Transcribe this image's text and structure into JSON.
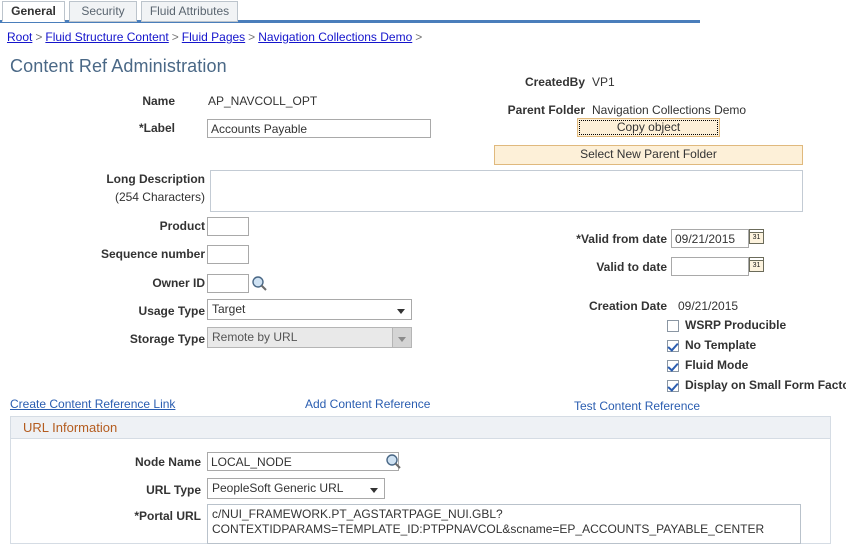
{
  "tabs": [
    {
      "label": "General",
      "active": true
    },
    {
      "label": "Security",
      "active": false
    },
    {
      "label": "Fluid Attributes",
      "active": false
    }
  ],
  "breadcrumb": {
    "items": [
      "Root",
      "Fluid Structure Content",
      "Fluid Pages",
      "Navigation Collections Demo"
    ],
    "separator": ">",
    "trailing": ">"
  },
  "page": {
    "title": "Content Ref Administration"
  },
  "general": {
    "name_label": "Name",
    "name_value": "AP_NAVCOLL_OPT",
    "label_label": "*Label",
    "label_value": "Accounts Payable",
    "long_description_label": "Long Description",
    "long_description_sub": "(254 Characters)",
    "long_description_value": "",
    "product_label": "Product",
    "product_value": "",
    "sequence_label": "Sequence number",
    "sequence_value": "",
    "owner_label": "Owner ID",
    "owner_value": "",
    "usage_type_label": "Usage Type",
    "usage_type_value": "Target",
    "storage_type_label": "Storage Type",
    "storage_type_value": "Remote by URL"
  },
  "right": {
    "created_by_label": "CreatedBy",
    "created_by_value": "VP1",
    "parent_folder_label": "Parent Folder",
    "parent_folder_value": "Navigation Collections Demo",
    "copy_object_button": "Copy object",
    "select_parent_button": "Select New Parent Folder",
    "valid_from_label": "*Valid from date",
    "valid_from_value": "09/21/2015",
    "valid_to_label": "Valid to date",
    "valid_to_value": "",
    "creation_date_label": "Creation Date",
    "creation_date_value": "09/21/2015",
    "calendar_icon_text": "31"
  },
  "checkboxes": [
    {
      "label": "WSRP Producible",
      "checked": false
    },
    {
      "label": "No Template",
      "checked": true
    },
    {
      "label": "Fluid Mode",
      "checked": true
    },
    {
      "label": "Display on  Small Form Factor",
      "checked": true
    }
  ],
  "links": {
    "create_content_reference_link": "Create Content Reference Link",
    "add_content_reference": "Add Content Reference",
    "test_content_reference": "Test Content Reference"
  },
  "url_information": {
    "panel_title": "URL Information",
    "node_name_label": "Node Name",
    "node_name_value": "LOCAL_NODE",
    "url_type_label": "URL Type",
    "url_type_value": "PeopleSoft Generic URL",
    "portal_url_label": "*Portal URL",
    "portal_url_value": "c/NUI_FRAMEWORK.PT_AGSTARTPAGE_NUI.GBL?CONTEXTIDPARAMS=TEMPLATE_ID:PTPPNAVCOL&scname=EP_ACCOUNTS_PAYABLE_CENTER"
  },
  "colors": {
    "accent_blue": "#4a7ebb",
    "title_blue": "#4a6886",
    "link_blue": "#2a5db0",
    "breadcrumb_blue": "#1414cc",
    "panel_header_orange": "#b45c1f",
    "button_cream": "#fdf0d8",
    "button_border": "#e0b97d"
  }
}
